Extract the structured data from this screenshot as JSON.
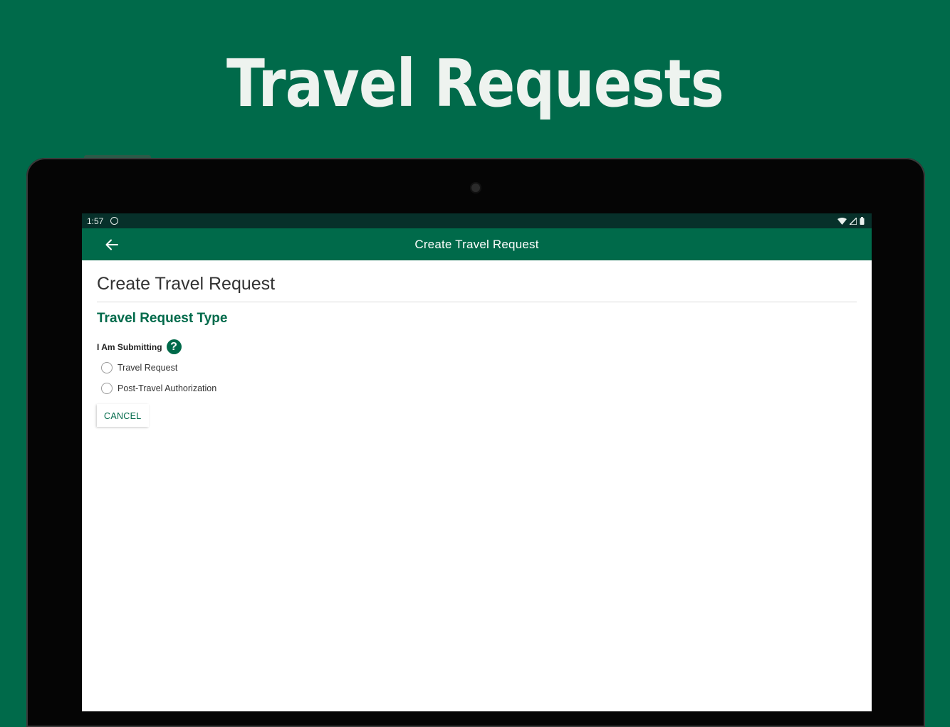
{
  "hero": {
    "title": "Travel Requests"
  },
  "status_bar": {
    "time": "1:57"
  },
  "app_bar": {
    "title": "Create Travel Request"
  },
  "page": {
    "heading": "Create Travel Request",
    "section_title": "Travel Request Type",
    "field_label": "I Am Submitting",
    "options": [
      {
        "label": "Travel Request",
        "selected": false
      },
      {
        "label": "Post-Travel Authorization",
        "selected": false
      }
    ],
    "cancel_label": "CANCEL"
  },
  "colors": {
    "brand_green": "#006a4a",
    "status_bar": "#07302a",
    "device_bezel": "#050505"
  },
  "icons": [
    "back-arrow-icon",
    "sync-icon",
    "wifi-icon",
    "signal-icon",
    "battery-icon",
    "help-icon"
  ]
}
